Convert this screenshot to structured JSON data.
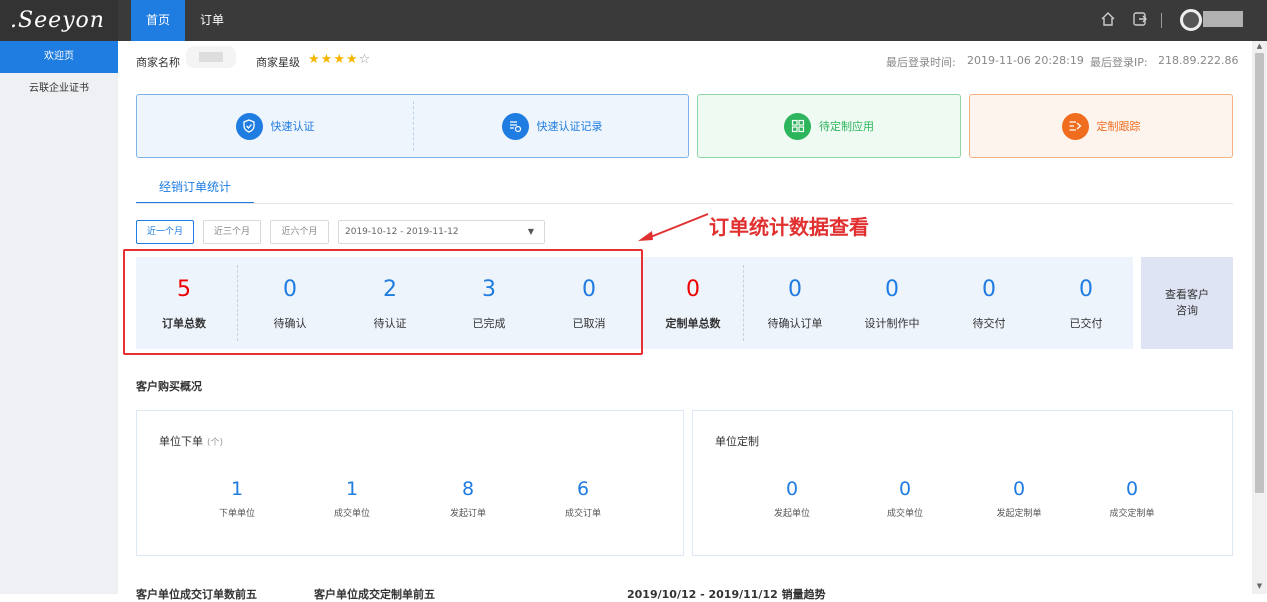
{
  "brand": {
    "logo_text": ".Seeyon"
  },
  "topnav": {
    "tabs": [
      "首页",
      "订单"
    ],
    "active": 0
  },
  "sidebar": {
    "items": [
      "欢迎页",
      "云联企业证书"
    ],
    "active": 0
  },
  "info": {
    "merchant_name_label": "商家名称",
    "merchant_level_label": "商家星级",
    "stars_filled": 4,
    "stars_total": 5,
    "last_login_time_label": "最后登录时间:",
    "last_login_time": "2019-11-06 20:28:19",
    "last_login_ip_label": "最后登录IP:",
    "last_login_ip": "218.89.222.86"
  },
  "quick_cards": {
    "card1": [
      "快速认证",
      "快速认证记录"
    ],
    "card2": "待定制应用",
    "card3": "定制跟踪"
  },
  "stats_tab": "经销订单统计",
  "annotation": "订单统计数据查看",
  "filters": {
    "buttons": [
      "近一个月",
      "近三个月",
      "近六个月"
    ],
    "active": 0,
    "date_range": "2019-10-12 - 2019-11-12"
  },
  "order_stats": [
    {
      "value": "5",
      "label": "订单总数"
    },
    {
      "value": "0",
      "label": "待确认"
    },
    {
      "value": "2",
      "label": "待认证"
    },
    {
      "value": "3",
      "label": "已完成"
    },
    {
      "value": "0",
      "label": "已取消"
    }
  ],
  "custom_stats": [
    {
      "value": "0",
      "label": "定制单总数"
    },
    {
      "value": "0",
      "label": "待确认订单"
    },
    {
      "value": "0",
      "label": "设计制作中"
    },
    {
      "value": "0",
      "label": "待交付"
    },
    {
      "value": "0",
      "label": "已交付"
    }
  ],
  "consult_button": "查看客户咨询",
  "customer_section": {
    "title": "客户购买概况",
    "orders_panel": {
      "title": "单位下单",
      "unit": "(个)",
      "stats": [
        {
          "value": "1",
          "label": "下单单位"
        },
        {
          "value": "1",
          "label": "成交单位"
        },
        {
          "value": "8",
          "label": "发起订单"
        },
        {
          "value": "6",
          "label": "成交订单"
        }
      ]
    },
    "custom_panel": {
      "title": "单位定制",
      "stats": [
        {
          "value": "0",
          "label": "发起单位"
        },
        {
          "value": "0",
          "label": "成交单位"
        },
        {
          "value": "0",
          "label": "发起定制单"
        },
        {
          "value": "0",
          "label": "成交定制单"
        }
      ]
    }
  },
  "bottom_headings": [
    "客户单位成交订单数前五",
    "客户单位成交定制单前五",
    "2019/10/12 - 2019/11/12 销量趋势"
  ],
  "colors": {
    "accent": "#1f7ce0",
    "topbar": "#3a3a3a",
    "sidebar": "#eef0f4",
    "highlight": "#e83030"
  }
}
